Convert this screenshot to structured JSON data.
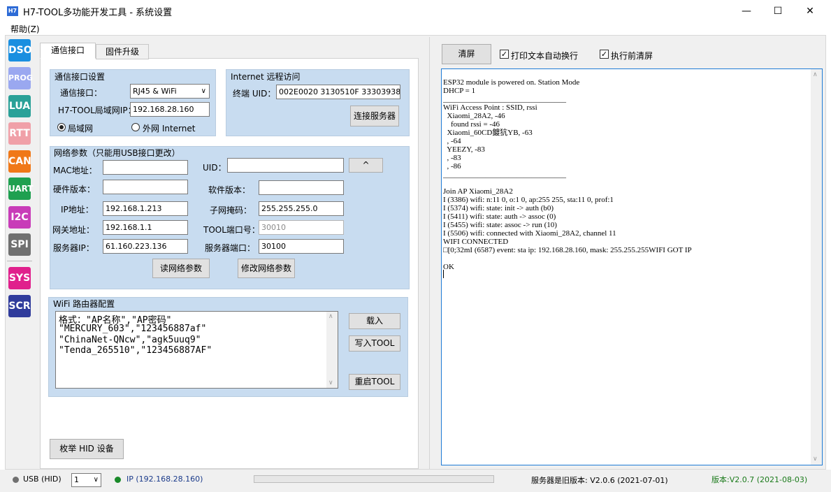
{
  "window": {
    "title": "H7-TOOL多功能开发工具 - 系统设置",
    "icon_text": "H7",
    "minimize": "—",
    "maximize": "☐",
    "close": "✕"
  },
  "menu": {
    "help": "帮助(Z)"
  },
  "toolbar": [
    {
      "label": "DSO",
      "color": "#1a8fe0"
    },
    {
      "label": "PROG",
      "color": "#9aa8f0"
    },
    {
      "label": "LUA",
      "color": "#2aa198"
    },
    {
      "label": "RTT",
      "color": "#f0a0a8"
    },
    {
      "label": "CAN",
      "color": "#f07818"
    },
    {
      "label": "UART",
      "color": "#1fa050"
    },
    {
      "label": "I2C",
      "color": "#c83cb8"
    },
    {
      "label": "SPI",
      "color": "#707070"
    },
    {
      "label": "SYS",
      "color": "#e0208c"
    },
    {
      "label": "SCR",
      "color": "#303c9c"
    }
  ],
  "tabs": {
    "comm": "通信接口",
    "firmware": "固件升级"
  },
  "comm_settings": {
    "title": "通信接口设置",
    "interface_label": "通信接口：",
    "interface_value": "RJ45 & WiFi",
    "lan_ip_label": "H7-TOOL局域网IP：",
    "lan_ip_value": "192.168.28.160",
    "radio_lan": "局域网",
    "radio_internet": "外网 Internet"
  },
  "internet": {
    "title": "Internet 远程访问",
    "uid_label": "终端 UID：",
    "uid_value": "002E0020 3130510F 33303938",
    "connect_button": "连接服务器"
  },
  "net_params": {
    "title": "网络参数（只能用USB接口更改）",
    "mac_label": "MAC地址：",
    "mac_value": "",
    "uid_label": "UID：",
    "uid_value": "",
    "uid_button": "^",
    "hw_label": "硬件版本：",
    "hw_value": "",
    "sw_label": "软件版本：",
    "sw_value": "",
    "ip_label": "IP地址：",
    "ip_value": "192.168.1.213",
    "mask_label": "子网掩码：",
    "mask_value": "255.255.255.0",
    "gw_label": "网关地址：",
    "gw_value": "192.168.1.1",
    "port_label": "TOOL端口号：",
    "port_value": "30010",
    "server_ip_label": "服务器IP：",
    "server_ip_value": "61.160.223.136",
    "server_port_label": "服务器端口：",
    "server_port_value": "30100",
    "read_button": "读网络参数",
    "write_button": "修改网络参数"
  },
  "wifi": {
    "title": "WiFi 路由器配置",
    "lines": [
      "格式：\"AP名称\",\"AP密码\"",
      "\"MERCURY_603\",\"123456887af\"",
      "\"ChinaNet-QNcw\",\"agk5uuq9\"",
      "\"Tenda_265510\",\"123456887AF\""
    ],
    "load_button": "载入",
    "write_button": "写入TOOL",
    "restart_button": "重启TOOL"
  },
  "enum_hid_button": "枚举 HID 设备",
  "console_toolbar": {
    "clear_button": "清屏",
    "auto_wrap": "打印文本自动换行",
    "clear_before_run": "执行前清屏"
  },
  "console_lines": [
    "ESP32 module is powered on. Station Mode",
    "DHCP = 1",
    "________________________________",
    "WiFi Access Point : SSID, rssi",
    "  Xiaomi_28A2, -46",
    "    found rssi = -46",
    "  Xiaomi_60CD鍍犺YB, -63",
    "  , -64",
    "  YEEZY, -83",
    "  , -83",
    "  , -86",
    "________________________________",
    "",
    "Join AP Xiaomi_28A2",
    "I (3386) wifi: n:11 0, o:1 0, ap:255 255, sta:11 0, prof:1",
    "I (5374) wifi: state: init -> auth (b0)",
    "I (5411) wifi: state: auth -> assoc (0)",
    "I (5455) wifi: state: assoc -> run (10)",
    "I (5506) wifi: connected with Xiaomi_28A2, channel 11",
    "WIFI CONNECTED",
    "□[0;32mI (6587) event: sta ip: 192.168.28.160, mask: 255.255.255WIFI GOT IP",
    "",
    "OK"
  ],
  "status": {
    "usb": "USB (HID)",
    "device_index": "1",
    "ip": "IP (192.168.28.160)",
    "server_version": "服务器是旧版本: V2.0.6 (2021-07-01)",
    "version": "版本:V2.0.7 (2021-08-03)",
    "usb_dot_color": "#707070",
    "ip_dot_color": "#1a8a2a",
    "version_color": "#1a7a1a"
  }
}
